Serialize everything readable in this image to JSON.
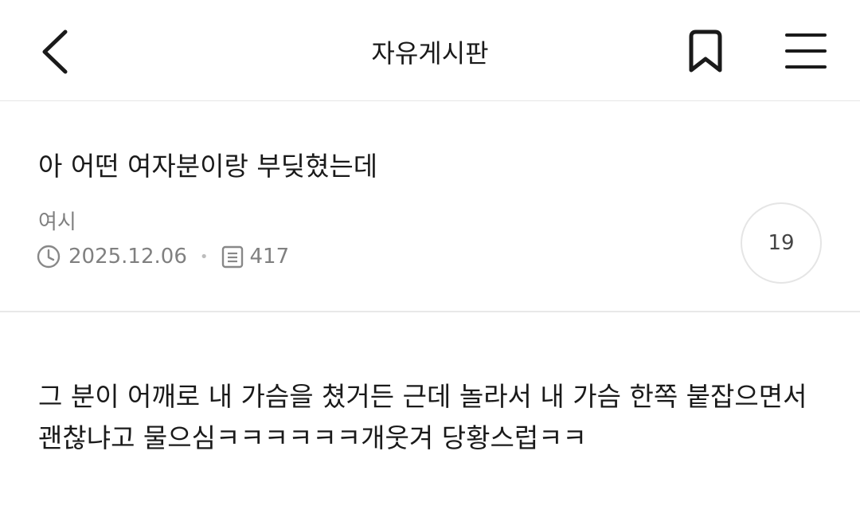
{
  "header": {
    "title": "자유게시판",
    "icons": {
      "back": "chevron-left-icon",
      "bookmark": "bookmark-icon",
      "menu": "hamburger-menu-icon"
    }
  },
  "post": {
    "title": "아 어떤 여자분이랑 부딪혔는데",
    "author": "여시",
    "date": "2025.12.06",
    "views": "417",
    "comment_count": "19",
    "body_lines": [
      "그 분이 어깨로 내 가슴을 쳤거든 근데 놀라서 내 가슴 한쪽 붙잡으면서",
      "괜찮냐고 물으심ㅋㅋㅋㅋㅋㅋ개웃겨 당황스럽ㅋㅋ"
    ]
  },
  "colors": {
    "text": "#1a1a1a",
    "meta": "#808080",
    "divider": "#e8e8e8"
  }
}
